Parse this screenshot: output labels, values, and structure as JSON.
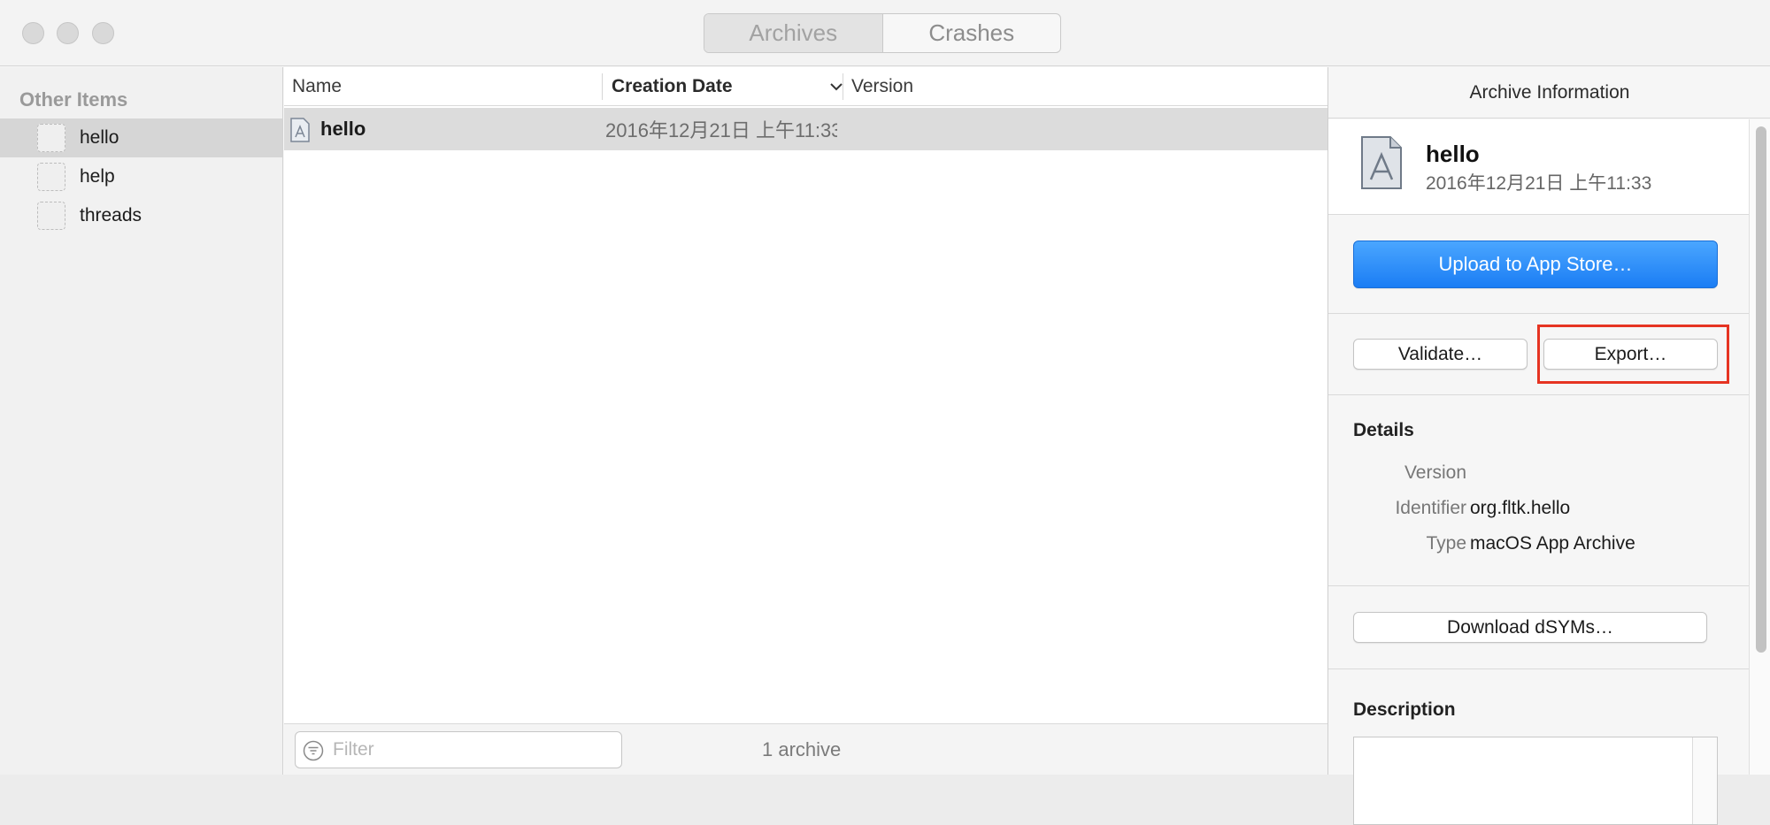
{
  "window": {
    "segments": [
      "Archives",
      "Crashes"
    ],
    "selected_segment": "Archives"
  },
  "sidebar": {
    "heading": "Other Items",
    "items": [
      {
        "label": "hello",
        "selected": true
      },
      {
        "label": "help",
        "selected": false
      },
      {
        "label": "threads",
        "selected": false
      }
    ]
  },
  "list": {
    "columns": [
      "Name",
      "Creation Date",
      "Version"
    ],
    "sorted_column": "Creation Date",
    "rows": [
      {
        "name": "hello",
        "creation_date": "2016年12月21日 上午11:33",
        "version": ""
      }
    ],
    "filter_placeholder": "Filter",
    "count_label": "1 archive"
  },
  "inspector": {
    "title": "Archive Information",
    "archive_name": "hello",
    "archive_date": "2016年12月21日 上午11:33",
    "upload_label": "Upload to App Store…",
    "validate_label": "Validate…",
    "export_label": "Export…",
    "details_heading": "Details",
    "details": {
      "version_key": "Version",
      "version_value": "",
      "identifier_key": "Identifier",
      "identifier_value": "org.fltk.hello",
      "type_key": "Type",
      "type_value": "macOS App Archive"
    },
    "download_dsyms_label": "Download dSYMs…",
    "description_heading": "Description"
  },
  "colors": {
    "accent_blue": "#1b7df4",
    "highlight_red": "#e63422",
    "selection_gray": "#dcdcdc"
  },
  "icons": [
    "close-light",
    "minimize-light",
    "zoom-light",
    "app-archive-icon",
    "filter-icon",
    "sort-chevron-down-icon"
  ]
}
